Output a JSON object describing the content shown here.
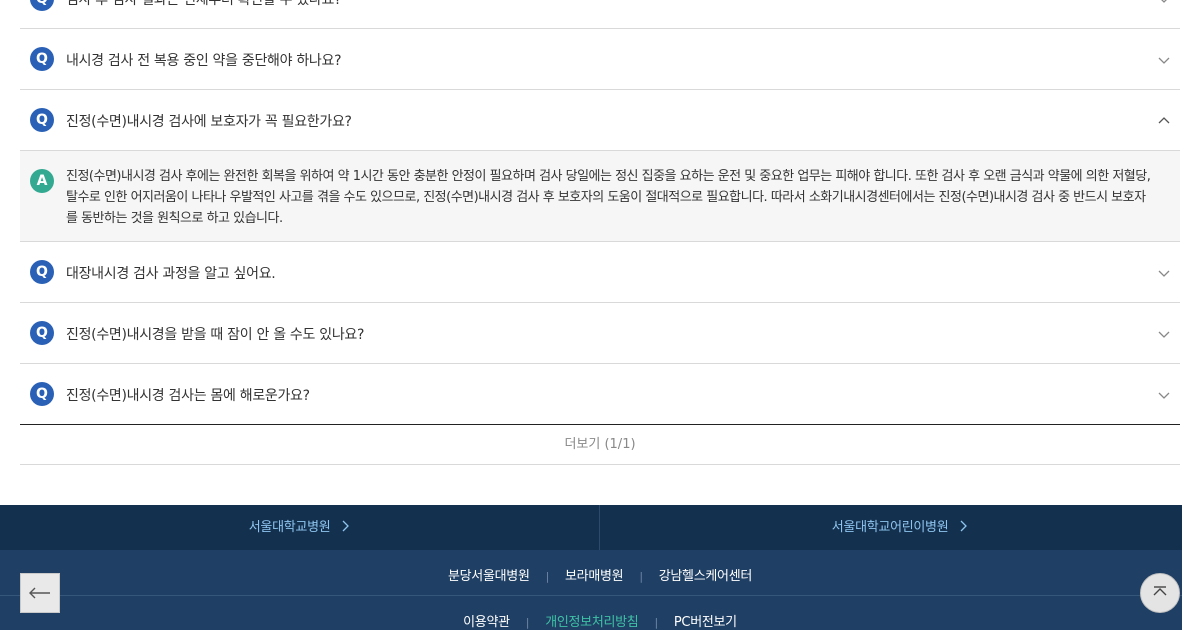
{
  "faq": {
    "items": [
      {
        "badge": "Q",
        "question": "검사 후 검사 결과는 언제부터 확인할 수 있나요?",
        "expanded": false
      },
      {
        "badge": "Q",
        "question": "내시경 검사 전 복용 중인 약을 중단해야 하나요?",
        "expanded": false
      },
      {
        "badge": "Q",
        "question": "진정(수면)내시경 검사에 보호자가 꼭 필요한가요?",
        "expanded": true,
        "answer_badge": "A",
        "answer": "진정(수면)내시경 검사 후에는 완전한 회복을 위하여 약 1시간 동안 충분한 안정이 필요하며 검사 당일에는 정신 집중을 요하는 운전 및 중요한 업무는 피해야 합니다. 또한 검사 후 오랜 금식과 약물에 의한 저혈당, 탈수로 인한 어지러움이 나타나 우발적인 사고를 겪을 수도 있으므로, 진정(수면)내시경 검사 후 보호자의 도움이 절대적으로 필요합니다. 따라서 소화기내시경센터에서는 진정(수면)내시경 검사 중 반드시 보호자를 동반하는 것을 원칙으로 하고 있습니다."
      },
      {
        "badge": "Q",
        "question": "대장내시경 검사 과정을 알고 싶어요.",
        "expanded": false
      },
      {
        "badge": "Q",
        "question": "진정(수면)내시경을 받을 때 잠이 안 올 수도 있나요?",
        "expanded": false
      },
      {
        "badge": "Q",
        "question": "진정(수면)내시경 검사는 몸에 해로운가요?",
        "expanded": false
      }
    ],
    "more_label": "더보기 (1/1)"
  },
  "footer": {
    "top_links": [
      "서울대학교병원",
      "서울대학교어린이병원"
    ],
    "affiliates": [
      "분당서울대병원",
      "보라매병원",
      "강남헬스케어센터"
    ],
    "policies": [
      "이용약관",
      "개인정보처리방침",
      "PC버전보기"
    ],
    "colors": {
      "top_bg": "#14304f",
      "mid_bg": "#1f3f64",
      "link": "#8ec5ef",
      "privacy": "#3fc1a6"
    }
  },
  "controls": {
    "back_icon": "arrow-left-icon",
    "top_icon": "chevron-up-icon"
  },
  "colors": {
    "q_badge": "#2a61b6",
    "a_badge": "#34a991",
    "answer_bg": "#f6f6f6"
  }
}
